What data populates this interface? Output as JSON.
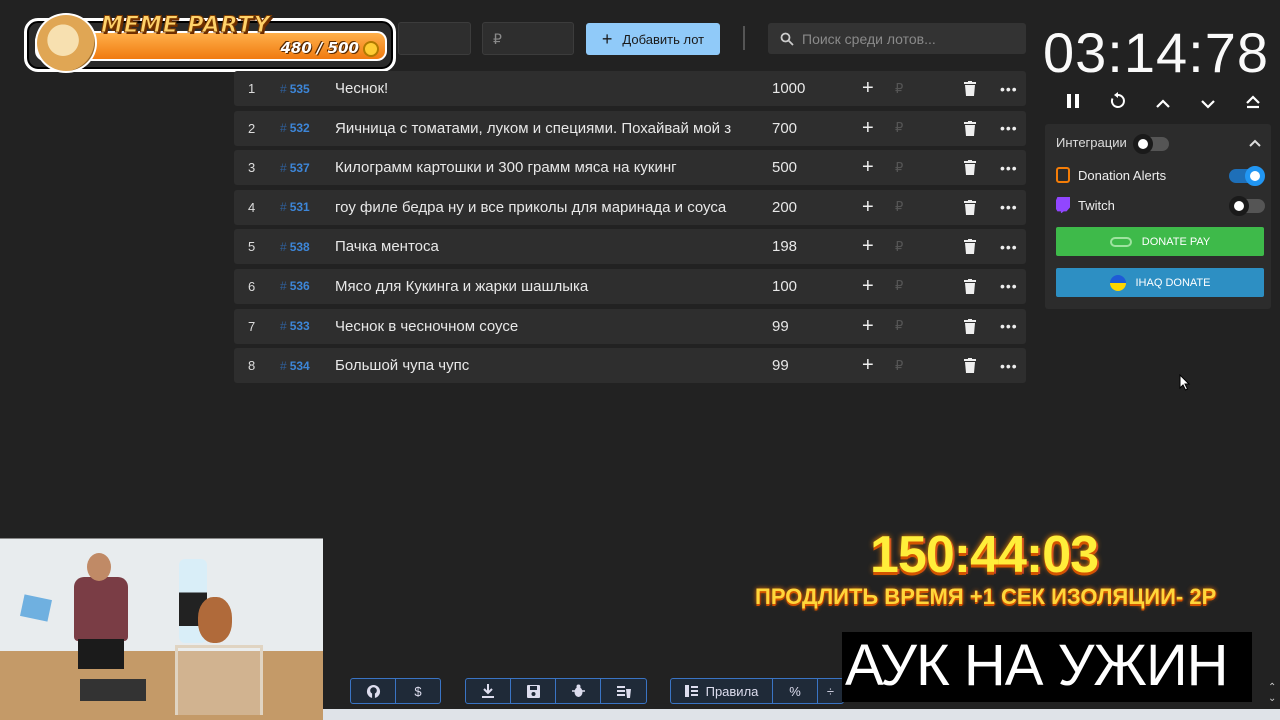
{
  "overlay": {
    "meme_title": "MEME PARTY",
    "meme_count": "480 / 500"
  },
  "toolbar": {
    "name_placeholder": "",
    "amount_placeholder": "₽",
    "add_label": "Добавить лот",
    "search_placeholder": "Поиск среди лотов..."
  },
  "lots": [
    {
      "pos": "1",
      "id": "535",
      "name": "Чеснок!",
      "amount": "1000"
    },
    {
      "pos": "2",
      "id": "532",
      "name": "Яичница с томатами, луком и специями. Похайвай мой з",
      "amount": "700"
    },
    {
      "pos": "3",
      "id": "537",
      "name": "Килограмм картошки и 300 грамм мяса на кукинг",
      "amount": "500"
    },
    {
      "pos": "4",
      "id": "531",
      "name": "гоу филе бедра ну и все приколы для маринада и соуса",
      "amount": "200"
    },
    {
      "pos": "5",
      "id": "538",
      "name": "Пачка ментоса",
      "amount": "198"
    },
    {
      "pos": "6",
      "id": "536",
      "name": "Мясо для Кукинга и жарки шашлыка",
      "amount": "100"
    },
    {
      "pos": "7",
      "id": "533",
      "name": "Чеснок в чесночном соусе",
      "amount": "99"
    },
    {
      "pos": "8",
      "id": "534",
      "name": "Большой чупа чупс",
      "amount": "99"
    }
  ],
  "lot_symbols": {
    "plus": "+",
    "ruble": "₽",
    "more": "•••",
    "hash": "#"
  },
  "timer": "03:14:78",
  "integrations": {
    "title": "Интеграции",
    "integrations_enabled": false,
    "donation_alerts_label": "Donation Alerts",
    "donation_alerts_enabled": true,
    "twitch_label": "Twitch",
    "twitch_enabled": false,
    "donatepay_label": "DONATE PAY",
    "iq_donate_label": "IHAQ DONATE"
  },
  "bottom_toolbar": {
    "rules_label": "Правила",
    "percent_label": "%"
  },
  "stream_overlay": {
    "big_timer": "150:44:03",
    "extend_text": "ПРОДЛИТЬ ВРЕМЯ +1 СЕК ИЗОЛЯЦИИ- 2Р",
    "title": "АУК НА УЖИН"
  },
  "colors": {
    "accent": "#90caf9",
    "background": "#222222",
    "row_bg": "#2e2e2e",
    "donatepay": "#3eba4a",
    "iq_donate": "#2d8fc3",
    "timer_overlay": "#ffee3a"
  }
}
